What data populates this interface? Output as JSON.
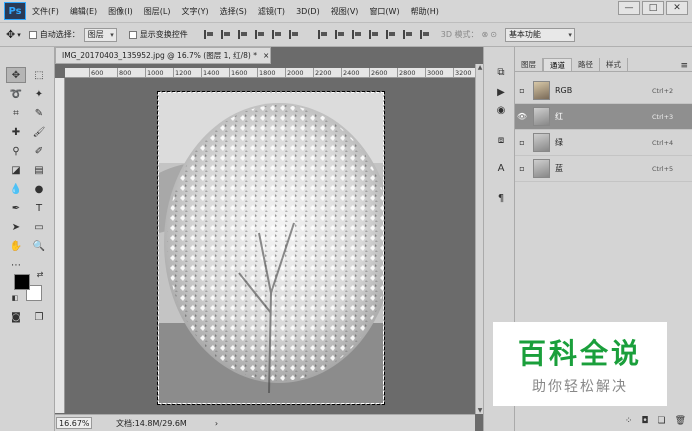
{
  "menubar": {
    "logo": "Ps",
    "items": [
      "文件(F)",
      "编辑(E)",
      "图像(I)",
      "图层(L)",
      "文字(Y)",
      "选择(S)",
      "滤镜(T)",
      "3D(D)",
      "视图(V)",
      "窗口(W)",
      "帮助(H)"
    ],
    "win_min": "—",
    "win_max": "□",
    "win_close": "✕"
  },
  "options": {
    "auto_select_label": "自动选择：",
    "auto_select_value": "图层",
    "show_transform_label": "显示变换控件",
    "mode_3d_label": "3D 模式：",
    "workspace": "基本功能"
  },
  "document": {
    "tab_title": "IMG_20170403_135952.jpg @ 16.7% (图层 1, 红/8) *",
    "tab_close": "×",
    "ruler_labels": [
      "600",
      "800",
      "1000",
      "1200",
      "1400",
      "1600",
      "1800",
      "2000",
      "2200",
      "2400",
      "2600",
      "2800",
      "3000",
      "3200"
    ],
    "zoom": "16.67%",
    "doc_info": "文档:14.8M/29.6M",
    "status_arrow": "›"
  },
  "panel": {
    "tabs": [
      "图层",
      "通道",
      "路径",
      "样式"
    ],
    "active_tab": "通道",
    "menu_icon": "≡",
    "channels": [
      {
        "name": "RGB",
        "shortcut": "Ctrl+2",
        "visible": false,
        "selected": false
      },
      {
        "name": "红",
        "shortcut": "Ctrl+3",
        "visible": true,
        "selected": true
      },
      {
        "name": "绿",
        "shortcut": "Ctrl+4",
        "visible": false,
        "selected": false
      },
      {
        "name": "蓝",
        "shortcut": "Ctrl+5",
        "visible": false,
        "selected": false
      }
    ]
  },
  "watermark": {
    "title": "百科全说",
    "subtitle": "助你轻松解决"
  },
  "colors": {
    "ui_gray": "#d4d4d4",
    "canvas_bg": "#6b6b6b",
    "selected_channel": "#8f8f8f",
    "watermark_green": "#1a9f3b"
  }
}
